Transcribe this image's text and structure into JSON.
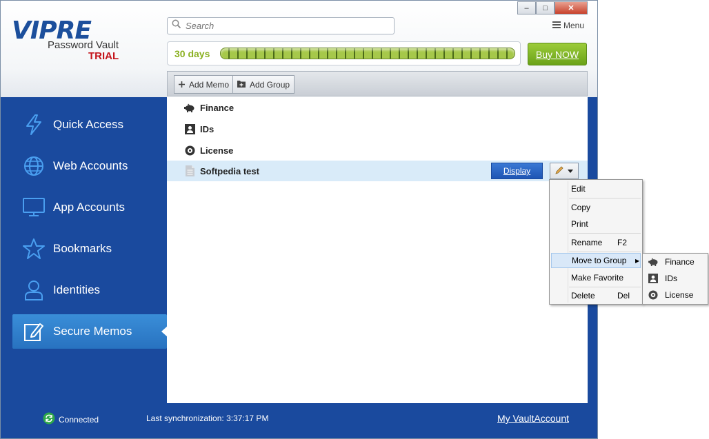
{
  "window": {
    "minimize": "–",
    "maximize": "□",
    "close": "✕"
  },
  "logo": {
    "main": "VIPRE",
    "product": "Password Vault",
    "edition": "TRIAL"
  },
  "search": {
    "placeholder": "Search"
  },
  "menu": {
    "label": "Menu"
  },
  "trial": {
    "days_label": "30 days",
    "progress": 1.0,
    "buy_label": "Buy NOW"
  },
  "sidebar": {
    "items": [
      {
        "label": "Quick Access",
        "icon": "lightning-icon"
      },
      {
        "label": "Web Accounts",
        "icon": "globe-icon"
      },
      {
        "label": "App Accounts",
        "icon": "monitor-icon"
      },
      {
        "label": "Bookmarks",
        "icon": "star-icon"
      },
      {
        "label": "Identities",
        "icon": "person-icon"
      },
      {
        "label": "Secure Memos",
        "icon": "memo-edit-icon"
      }
    ],
    "active_index": 5
  },
  "toolbar": {
    "add_memo": "Add Memo",
    "add_group": "Add Group"
  },
  "list": {
    "items": [
      {
        "label": "Finance",
        "icon": "piggy-bank-icon"
      },
      {
        "label": "IDs",
        "icon": "id-card-icon"
      },
      {
        "label": "License",
        "icon": "disc-icon"
      },
      {
        "label": "Softpedia test",
        "icon": "document-icon"
      }
    ],
    "selected_index": 3,
    "display_button": "Display"
  },
  "context_menu": {
    "edit": "Edit",
    "copy": "Copy",
    "print": "Print",
    "rename": "Rename",
    "rename_shortcut": "F2",
    "move_to_group": "Move to Group",
    "make_favorite": "Make Favorite",
    "delete": "Delete",
    "delete_shortcut": "Del"
  },
  "submenu": {
    "items": [
      {
        "label": "Finance",
        "icon": "piggy-bank-icon"
      },
      {
        "label": "IDs",
        "icon": "id-card-icon"
      },
      {
        "label": "License",
        "icon": "disc-icon"
      }
    ]
  },
  "status": {
    "connected": "Connected",
    "sync": "Last synchronization: 3:37:17 PM",
    "account_link": "My VaultAccount"
  },
  "colors": {
    "sidebar_bg": "#1a4a9e",
    "active_nav": "#2f80cc",
    "trial_green": "#8ab020",
    "buy_green": "#7cb228",
    "edition_red": "#c4141c"
  }
}
